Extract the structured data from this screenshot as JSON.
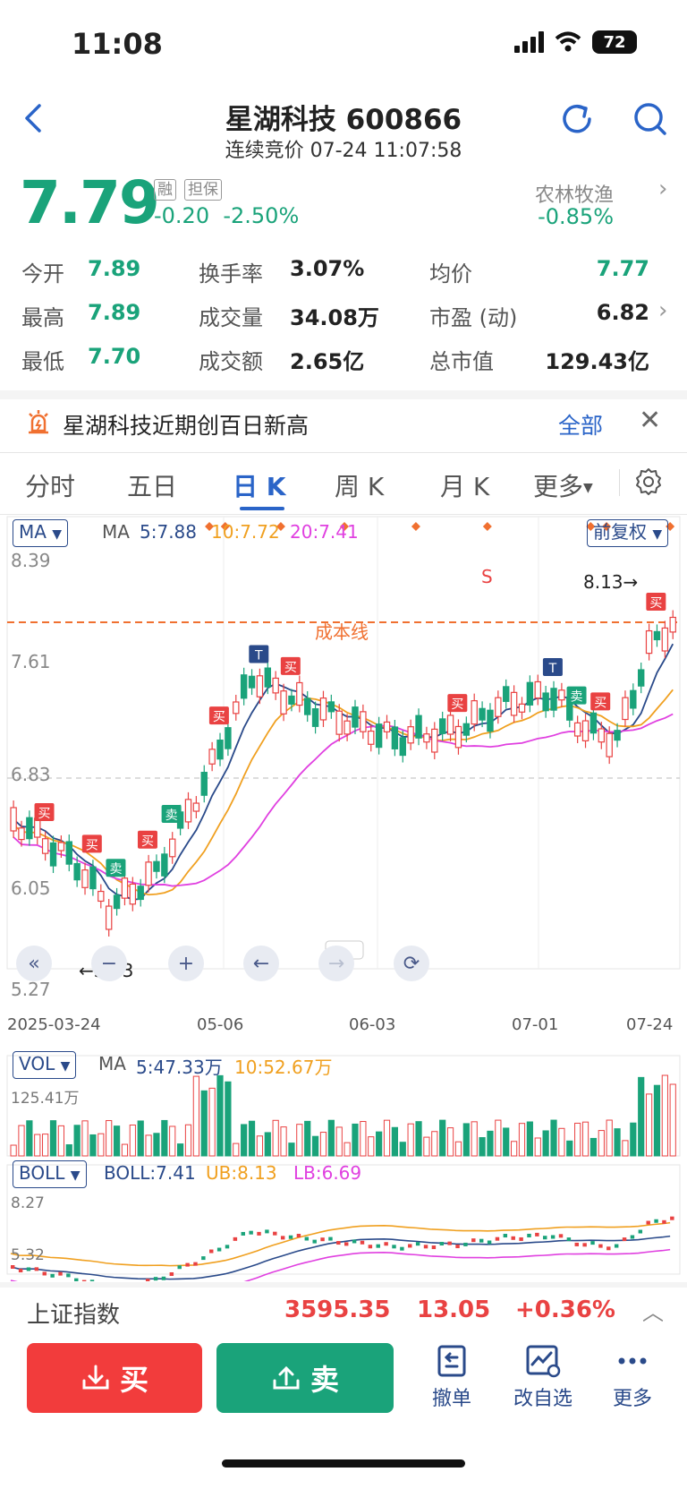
{
  "status_bar": {
    "time": "11:08",
    "battery": "72"
  },
  "header": {
    "title": "星湖科技 600866",
    "subtitle": "连续竞价 07-24 11:07:58"
  },
  "quote": {
    "price": "7.79",
    "tag_margin": "融",
    "tag_collateral": "担保",
    "change": "-0.20  -2.50%",
    "sector_name": "农林牧渔",
    "sector_change": "-0.85%"
  },
  "stats": {
    "open_label": "今开",
    "open": "7.89",
    "high_label": "最高",
    "high": "7.89",
    "low_label": "最低",
    "low": "7.70",
    "turnover_rate_label": "换手率",
    "turnover_rate": "3.07%",
    "volume_label": "成交量",
    "volume": "34.08万",
    "amount_label": "成交额",
    "amount": "2.65亿",
    "avg_label": "均价",
    "avg": "7.77",
    "pe_label": "市盈 (动)",
    "pe": "6.82",
    "mcap_label": "总市值",
    "mcap": "129.43亿"
  },
  "notice": {
    "text": "星湖科技近期创百日新高",
    "all": "全部"
  },
  "tabs": [
    "分时",
    "五日",
    "日 K",
    "周 K",
    "月 K",
    "更多"
  ],
  "kline": {
    "ma_selector": "MA",
    "ma_label": "MA",
    "ma5": "5:7.88",
    "ma10": "10:7.72",
    "ma20": "20:7.41",
    "adjust": "前复权",
    "y_ticks": [
      "8.39",
      "7.61",
      "6.83",
      "6.05",
      "5.27"
    ],
    "cost_line_label": "成本线",
    "max_label": "8.13→",
    "min_label": "←5.53",
    "marker_s": "S",
    "marker_t": "T",
    "buy_marker": "买",
    "sell_marker": "卖",
    "dates": [
      "2025-03-24",
      "05-06",
      "06-03",
      "07-01",
      "07-24"
    ]
  },
  "volume_panel": {
    "selector": "VOL",
    "ma_label": "MA",
    "ma5": "5:47.33万",
    "ma10": "10:52.67万",
    "max": "125.41万"
  },
  "boll_panel": {
    "selector": "BOLL",
    "boll": "BOLL:7.41",
    "ub": "UB:8.13",
    "lb": "LB:6.69",
    "top": "8.27",
    "bottom": "5.32"
  },
  "index_bar": {
    "name": "上证指数",
    "value": "3595.35",
    "change": "13.05",
    "pct": "+0.36%"
  },
  "bottom_bar": {
    "buy": "买",
    "sell": "卖",
    "cancel": "撤单",
    "watchlist": "改自选",
    "more": "更多"
  },
  "colors": {
    "up": "#e94242",
    "down": "#1aa37a",
    "accent": "#2a64c8",
    "ma5": "#2a4a8a",
    "ma10": "#f0a020",
    "ma20": "#e040e0",
    "cost_line": "#f07030"
  }
}
